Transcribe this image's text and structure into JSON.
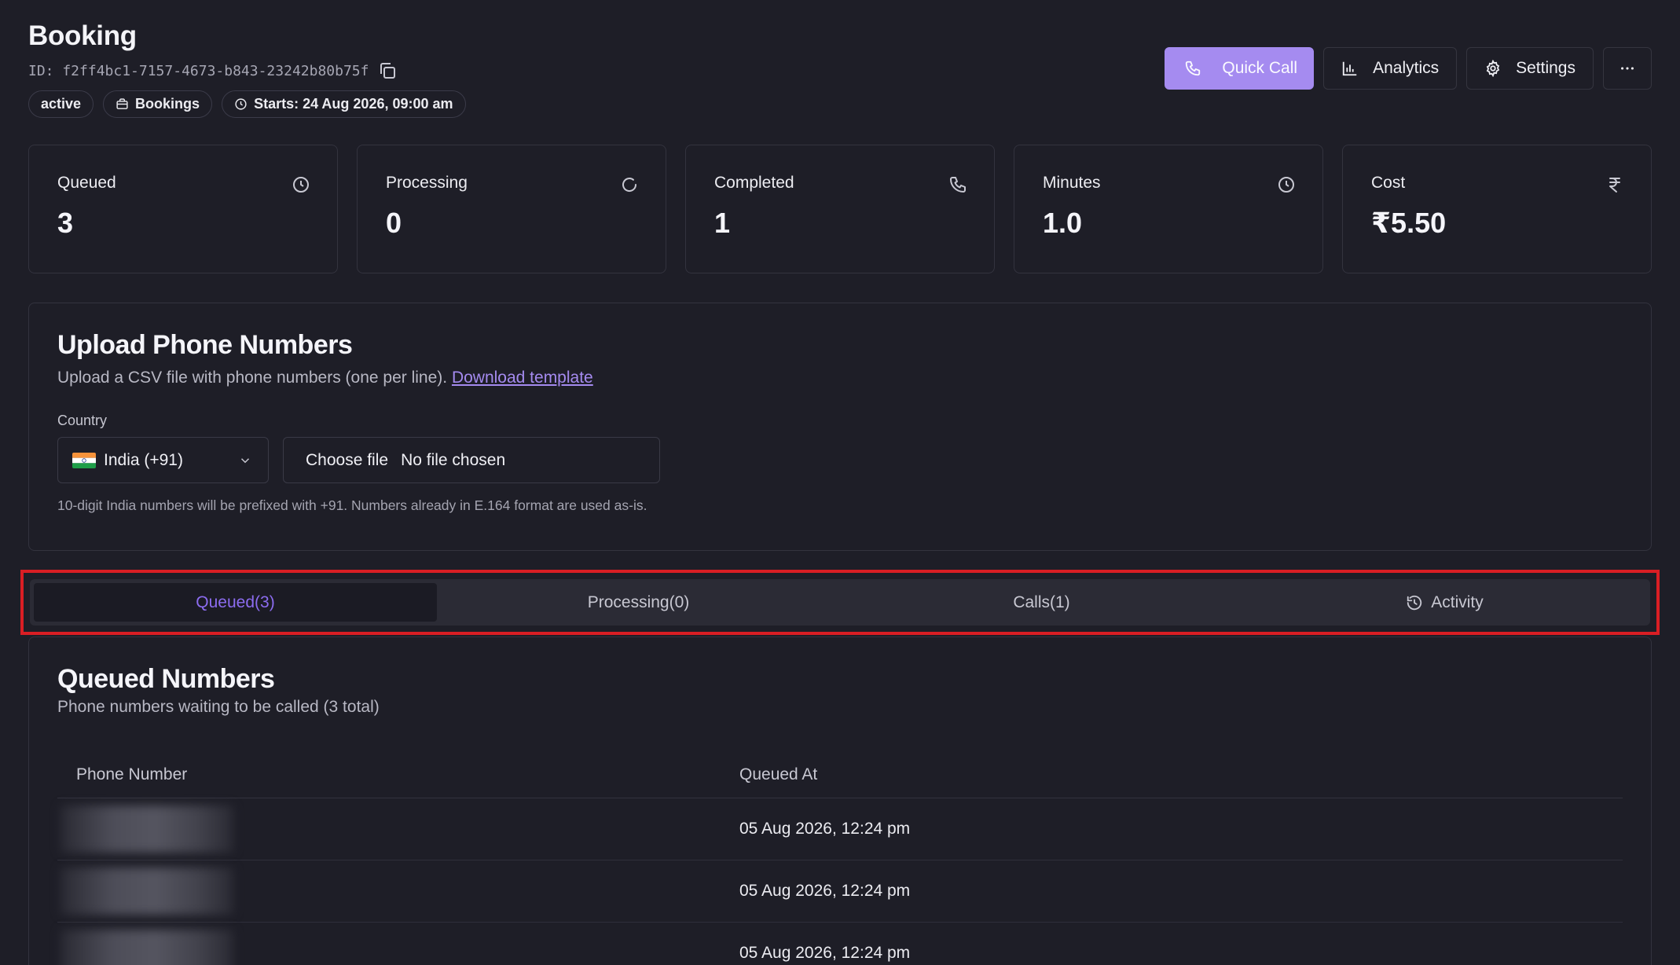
{
  "header": {
    "title": "Booking",
    "id_label": "ID: f2ff4bc1-7157-4673-b843-23242b80b75f",
    "badges": {
      "status": "active",
      "category": "Bookings",
      "starts": "Starts: 24 Aug 2026, 09:00 am"
    },
    "actions": {
      "quick_call": "Quick Call",
      "analytics": "Analytics",
      "settings": "Settings",
      "more": "···"
    }
  },
  "stats": [
    {
      "label": "Queued",
      "value": "3",
      "icon": "clock-icon"
    },
    {
      "label": "Processing",
      "value": "0",
      "icon": "spinner-icon"
    },
    {
      "label": "Completed",
      "value": "1",
      "icon": "phone-icon"
    },
    {
      "label": "Minutes",
      "value": "1.0",
      "icon": "clock-icon"
    },
    {
      "label": "Cost",
      "value": "₹5.50",
      "icon": "rupee-icon"
    }
  ],
  "upload": {
    "title": "Upload Phone Numbers",
    "subtitle": "Upload a CSV file with phone numbers (one per line).",
    "template_link": "Download template",
    "country_label": "Country",
    "country_value": "India (+91)",
    "file_button": "Choose file",
    "file_status": "No file chosen",
    "hint": "10-digit India numbers will be prefixed with +91. Numbers already in E.164 format are used as-is."
  },
  "tabs": [
    {
      "label": "Queued(3)",
      "active": true
    },
    {
      "label": "Processing(0)",
      "active": false
    },
    {
      "label": "Calls(1)",
      "active": false
    },
    {
      "label": "Activity",
      "active": false
    }
  ],
  "queued": {
    "title": "Queued Numbers",
    "subtitle": "Phone numbers waiting to be called (3 total)",
    "columns": [
      "Phone Number",
      "Queued At"
    ],
    "rows": [
      {
        "queued_at": "05 Aug 2026, 12:24 pm"
      },
      {
        "queued_at": "05 Aug 2026, 12:24 pm"
      },
      {
        "queued_at": "05 Aug 2026, 12:24 pm"
      }
    ]
  },
  "colors": {
    "background": "#1e1e27",
    "accent": "#a58bf0",
    "tab_active_text": "#8c6cf0",
    "highlight_border": "#d91e24"
  }
}
